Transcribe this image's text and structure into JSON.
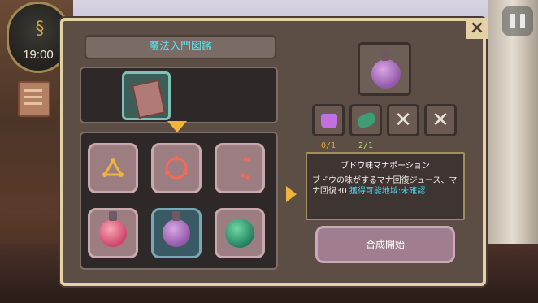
{
  "hud": {
    "clock_time": "19:00"
  },
  "panel": {
    "title": "魔法入門図鑑"
  },
  "item": {
    "name": "ブドウ味マナポーション",
    "description": "ブドウの味がするマナ回復ジュース、マナ回復30",
    "location_label": "獲得可能地域:未確認"
  },
  "materials": [
    {
      "icon": "purple-jelly-icon",
      "count": "0/1"
    },
    {
      "icon": "green-leaf-icon",
      "count": "2/1"
    },
    {
      "icon": "empty-x-icon",
      "count": ""
    },
    {
      "icon": "empty-x-icon",
      "count": ""
    }
  ],
  "recipes": [
    {
      "icon": "triangle-rune-icon"
    },
    {
      "icon": "ring-rune-icon"
    },
    {
      "icon": "dots-rune-icon"
    },
    {
      "icon": "red-potion-icon"
    },
    {
      "icon": "purple-potion-icon",
      "selected": true
    },
    {
      "icon": "green-orb-icon"
    }
  ],
  "buttons": {
    "craft_label": "合成開始"
  },
  "colors": {
    "panel_bg": "#5c4e45",
    "panel_border": "#e4d2a6",
    "title_text": "#5fe0ee",
    "accent_arrow": "#f0b33b",
    "link_text": "#4fd0e8",
    "count_short": "#e0a23d",
    "count_ok": "#a9e36c"
  }
}
